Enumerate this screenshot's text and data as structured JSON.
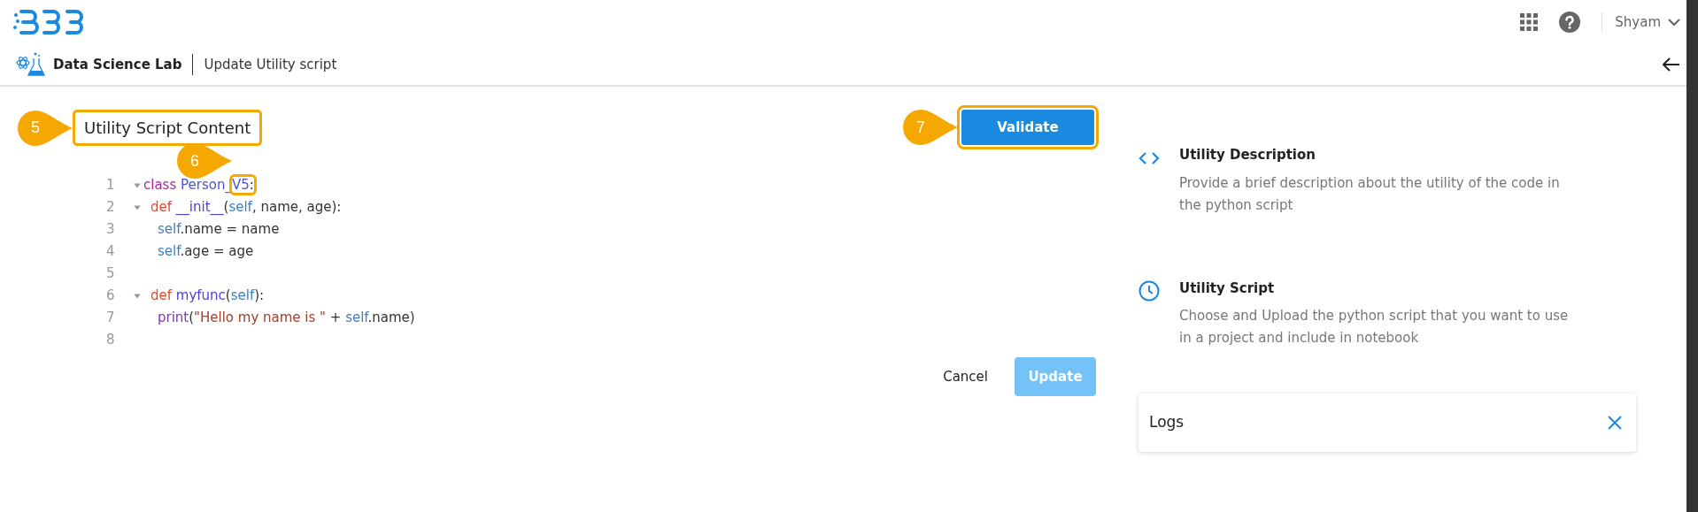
{
  "header": {
    "user": "Shyam"
  },
  "breadcrumb": {
    "app": "Data Science Lab",
    "page": "Update Utility script"
  },
  "editor": {
    "title": "Utility Script Content",
    "title_callout": "5",
    "token_callout": "6",
    "lines": [
      {
        "number": "1",
        "foldable": true,
        "kind": "class",
        "tokens": [
          {
            "text": "class ",
            "kind": "keyword"
          },
          {
            "text": "Person_",
            "kind": "class"
          },
          {
            "text": "V5",
            "kind": "class",
            "highlighted": true
          },
          {
            "text": ":",
            "kind": "plain",
            "highlighted": true
          }
        ]
      },
      {
        "number": "2",
        "foldable": true,
        "kind": "method",
        "tokens": [
          {
            "text": "def ",
            "kind": "def"
          },
          {
            "text": "__init__",
            "kind": "function"
          },
          {
            "text": "(",
            "kind": "plain"
          },
          {
            "text": "self",
            "kind": "self"
          },
          {
            "text": ", name, age):",
            "kind": "plain"
          }
        ]
      },
      {
        "number": "3",
        "foldable": false,
        "kind": "statement",
        "tokens": [
          {
            "text": "self",
            "kind": "self"
          },
          {
            "text": ".name = name",
            "kind": "plain"
          }
        ]
      },
      {
        "number": "4",
        "foldable": false,
        "kind": "statement",
        "tokens": [
          {
            "text": "self",
            "kind": "self"
          },
          {
            "text": ".age = age",
            "kind": "plain"
          }
        ]
      },
      {
        "number": "5",
        "foldable": false
      },
      {
        "number": "6",
        "foldable": true,
        "kind": "method",
        "tokens": [
          {
            "text": "def ",
            "kind": "def"
          },
          {
            "text": "myfunc",
            "kind": "function"
          },
          {
            "text": "(",
            "kind": "plain"
          },
          {
            "text": "self",
            "kind": "self"
          },
          {
            "text": "):",
            "kind": "plain"
          }
        ]
      },
      {
        "number": "7",
        "foldable": false,
        "kind": "statement",
        "tokens": [
          {
            "text": "print",
            "kind": "builtin"
          },
          {
            "text": "(",
            "kind": "plain"
          },
          {
            "text": "\"Hello my name is \"",
            "kind": "string"
          },
          {
            "text": " + ",
            "kind": "plain"
          },
          {
            "text": "self",
            "kind": "self"
          },
          {
            "text": ".name)",
            "kind": "plain"
          }
        ]
      },
      {
        "number": "8",
        "foldable": false
      }
    ]
  },
  "validate": {
    "label": "Validate",
    "callout": "7"
  },
  "actions": {
    "cancel": "Cancel",
    "update": {
      "label": "Update",
      "disabled": true
    }
  },
  "info": [
    {
      "kind": "code",
      "title": "Utility Description",
      "text": "Provide a brief description about the utility of the code in the python script"
    },
    {
      "kind": "clock",
      "title": "Utility Script",
      "text": "Choose and Upload the python script that you want to use in a project and include in notebook"
    }
  ],
  "logs": {
    "title": "Logs"
  }
}
